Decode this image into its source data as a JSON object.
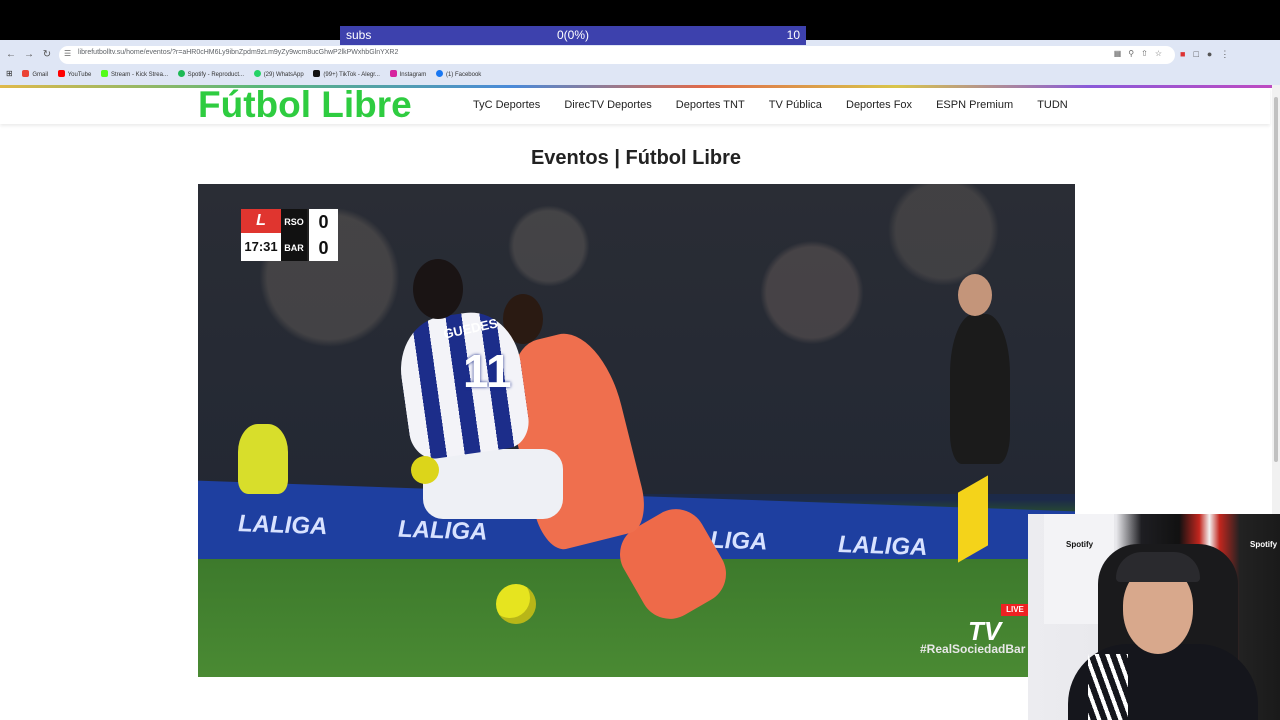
{
  "overlay": {
    "subs_label": "subs",
    "subs_value": "0(0%)",
    "subs_goal": "10"
  },
  "browser": {
    "url": "librefutbolltv.su/home/eventos/?r=aHR0cHM6Ly9ibnZpdm9zLm9yZy9wcm8ucGhwP2lkPWxhbGlnYXR2",
    "bookmarks": [
      {
        "label": "Gmail",
        "color": "#ea4335"
      },
      {
        "label": "YouTube",
        "color": "#ff0000"
      },
      {
        "label": "Stream - Kick Strea...",
        "color": "#53fc18"
      },
      {
        "label": "Spotify - Reproduct...",
        "color": "#1db954"
      },
      {
        "label": "(29) WhatsApp",
        "color": "#25d366"
      },
      {
        "label": "(99+) TikTok - Alegr...",
        "color": "#111111"
      },
      {
        "label": "Instagram",
        "color": "#d6249f"
      },
      {
        "label": "(1) Facebook",
        "color": "#1877f2"
      }
    ]
  },
  "site": {
    "logo": "Fútbol Libre",
    "nav": [
      "TyC Deportes",
      "DirecTV Deportes",
      "Deportes TNT",
      "TV Pública",
      "Deportes Fox",
      "ESPN Premium",
      "TUDN"
    ],
    "page_title": "Eventos | Fútbol Libre"
  },
  "video": {
    "scorebug": {
      "league_logo": "L",
      "clock": "17:31",
      "home_team": "RSO",
      "home_score": "0",
      "away_team": "BAR",
      "away_score": "0"
    },
    "player_name": "GUEDES",
    "player_number": "11",
    "ad_text": "LALIGA",
    "live_badge": "LIVE",
    "tv_logo": "TV",
    "hashtag": "#RealSociedadBar"
  },
  "webcam": {
    "sponsor": "Spotify"
  }
}
